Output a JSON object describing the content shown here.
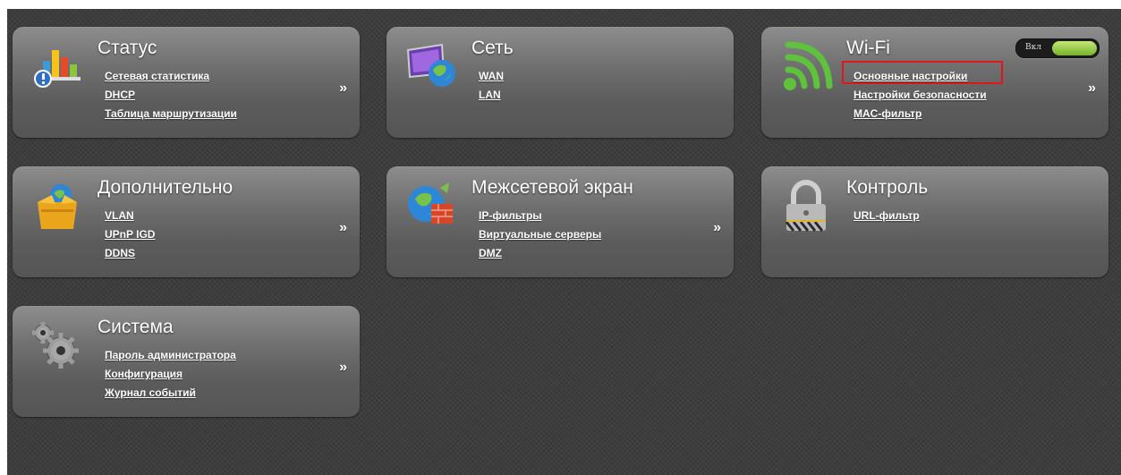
{
  "accent_colors": {
    "highlight_border": "#e0161b",
    "toggle_on": "#77b32a",
    "background": "#3b3b3b"
  },
  "more_glyph": "»",
  "tiles": [
    {
      "id": "status",
      "title": "Статус",
      "icon": "bar-chart-icon",
      "links": [
        "Сетевая статистика",
        "DHCP",
        "Таблица маршрутизации"
      ]
    },
    {
      "id": "network",
      "title": "Сеть",
      "icon": "monitor-globe-icon",
      "links": [
        "WAN",
        "LAN"
      ]
    },
    {
      "id": "wifi",
      "title": "Wi-Fi",
      "icon": "wifi-icon",
      "toggle_label": "Вкл",
      "toggle_state": "on",
      "highlighted_link": "Основные настройки",
      "links": [
        "Основные настройки",
        "Настройки безопасности",
        "MAC-фильтр"
      ]
    },
    {
      "id": "advanced",
      "title": "Дополнительно",
      "icon": "open-box-icon",
      "links": [
        "VLAN",
        "UPnP IGD",
        "DDNS"
      ]
    },
    {
      "id": "firewall",
      "title": "Межсетевой экран",
      "icon": "globe-firewall-icon",
      "links": [
        "IP-фильтры",
        "Виртуальные серверы",
        "DMZ"
      ]
    },
    {
      "id": "control",
      "title": "Контроль",
      "icon": "padlock-icon",
      "links": [
        "URL-фильтр"
      ]
    },
    {
      "id": "system",
      "title": "Система",
      "icon": "gears-icon",
      "links": [
        "Пароль администратора",
        "Конфигурация",
        "Журнал событий"
      ]
    }
  ]
}
